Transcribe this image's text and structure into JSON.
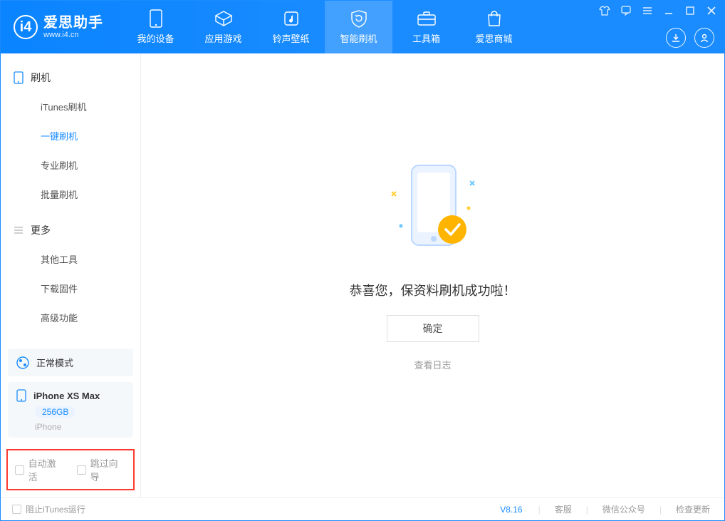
{
  "app": {
    "title": "爱思助手",
    "subtitle": "www.i4.cn"
  },
  "nav": {
    "tabs": [
      {
        "label": "我的设备"
      },
      {
        "label": "应用游戏"
      },
      {
        "label": "铃声壁纸"
      },
      {
        "label": "智能刷机"
      },
      {
        "label": "工具箱"
      },
      {
        "label": "爱思商城"
      }
    ]
  },
  "sidebar": {
    "section1": {
      "title": "刷机",
      "items": [
        {
          "label": "iTunes刷机"
        },
        {
          "label": "一键刷机"
        },
        {
          "label": "专业刷机"
        },
        {
          "label": "批量刷机"
        }
      ]
    },
    "section2": {
      "title": "更多",
      "items": [
        {
          "label": "其他工具"
        },
        {
          "label": "下载固件"
        },
        {
          "label": "高级功能"
        }
      ]
    },
    "mode_label": "正常模式",
    "device": {
      "name": "iPhone XS Max",
      "storage": "256GB",
      "type": "iPhone"
    },
    "checkboxes": {
      "auto_activate": "自动激活",
      "skip_guide": "跳过向导"
    }
  },
  "main": {
    "success_title": "恭喜您，保资料刷机成功啦！",
    "ok_button": "确定",
    "view_log": "查看日志"
  },
  "statusbar": {
    "block_itunes": "阻止iTunes运行",
    "version": "V8.16",
    "links": {
      "support": "客服",
      "wechat": "微信公众号",
      "check_update": "检查更新"
    }
  }
}
